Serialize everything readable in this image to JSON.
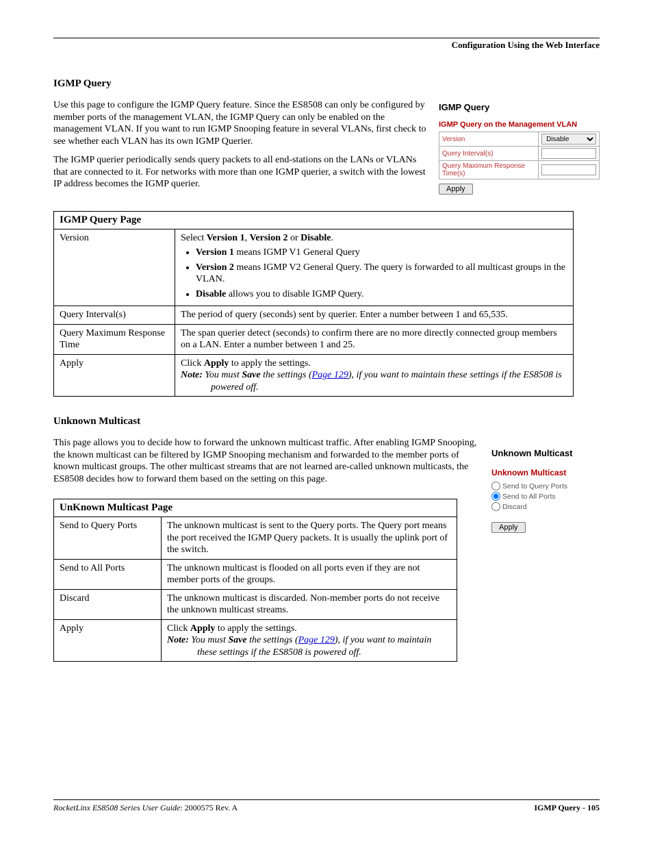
{
  "header": {
    "right": "Configuration Using the Web Interface"
  },
  "igmp": {
    "heading": "IGMP Query",
    "para1": "Use this page to configure the IGMP Query feature. Since the ES8508 can only be configured by member ports of the management VLAN, the IGMP Query can only be enabled on the management VLAN. If you want to run IGMP Snooping feature in several VLANs, first check to see whether each VLAN has its own IGMP Querier.",
    "para2": "The IGMP querier periodically sends query packets to all end-stations on the LANs or VLANs that are connected to it. For networks with more than one IGMP querier, a switch with the lowest IP address becomes the IGMP querier.",
    "panel": {
      "title": "IGMP Query",
      "subtitle": "IGMP Query on the Management VLAN",
      "rows": {
        "version_label": "Version",
        "version_value": "Disable",
        "interval_label": "Query Interval(s)",
        "interval_value": "",
        "qmrt_label": "Query Maximum Response Time(s)",
        "qmrt_value": ""
      },
      "apply": "Apply"
    },
    "table": {
      "caption": "IGMP Query Page",
      "version": {
        "label": "Version",
        "intro_a": "Select ",
        "intro_b1": "Version 1",
        "intro_sep1": ", ",
        "intro_b2": "Version 2",
        "intro_sep2": " or ",
        "intro_b3": "Disable",
        "intro_end": ".",
        "bul1_b": "Version 1",
        "bul1_t": " means IGMP V1 General Query",
        "bul2_b": "Version 2",
        "bul2_t": " means IGMP V2 General Query. The query is forwarded to all multicast groups in the VLAN.",
        "bul3_b": "Disable",
        "bul3_t": " allows you to disable IGMP Query."
      },
      "interval": {
        "label": "Query Interval(s)",
        "text": "The period of query (seconds) sent by querier. Enter a number between 1 and 65,535."
      },
      "qmrt": {
        "label": "Query Maximum Response Time",
        "text": "The span querier detect (seconds) to confirm there are no more directly connected group members on a LAN. Enter a number between 1 and 25."
      },
      "apply": {
        "label": "Apply",
        "l1a": "Click ",
        "l1b": "Apply",
        "l1c": " to apply the settings.",
        "note_b1": "Note:",
        "note_t1": " You must ",
        "note_b2": "Save",
        "note_t2": " the settings (",
        "note_link": "Page 129",
        "note_t3": "), if you want to maintain these settings if the ES8508 is powered off."
      }
    }
  },
  "um": {
    "heading": "Unknown Multicast",
    "para": "This page allows you to decide how to forward the unknown multicast traffic. After enabling IGMP Snooping, the known multicast can be filtered by IGMP Snooping mechanism and forwarded to the member ports of known multicast groups. The other multicast streams that are not learned are-called unknown multicasts, the ES8508 decides how to forward them based on the setting on this page.",
    "panel": {
      "title": "Unknown Multicast",
      "subtitle": "Unknown Multicast",
      "opt1": "Send to Query Ports",
      "opt2": "Send to All Ports",
      "opt3": "Discard",
      "selected": "opt2",
      "apply": "Apply"
    },
    "table": {
      "caption": "UnKnown Multicast Page",
      "r1": {
        "label": "Send to Query Ports",
        "text": "The unknown multicast is sent to the Query ports. The Query port means the port received the IGMP Query packets. It is usually the uplink port of the switch."
      },
      "r2": {
        "label": "Send to All Ports",
        "text": "The unknown multicast is flooded on all ports even if they are not member ports of the groups."
      },
      "r3": {
        "label": "Discard",
        "text": "The unknown multicast is discarded. Non-member ports do not receive the unknown multicast streams."
      },
      "apply": {
        "label": "Apply",
        "l1a": "Click ",
        "l1b": "Apply",
        "l1c": " to apply the settings.",
        "note_b1": "Note:",
        "note_t1": " You must ",
        "note_b2": "Save",
        "note_t2": " the settings (",
        "note_link": "Page 129",
        "note_t3": "), if you want to maintain these settings if the ES8508 is powered off."
      }
    }
  },
  "footer": {
    "left_i": "RocketLinx ES8508 Series  User Guide",
    "left_r": ": 2000575 Rev. A",
    "right": "IGMP Query - 105"
  }
}
